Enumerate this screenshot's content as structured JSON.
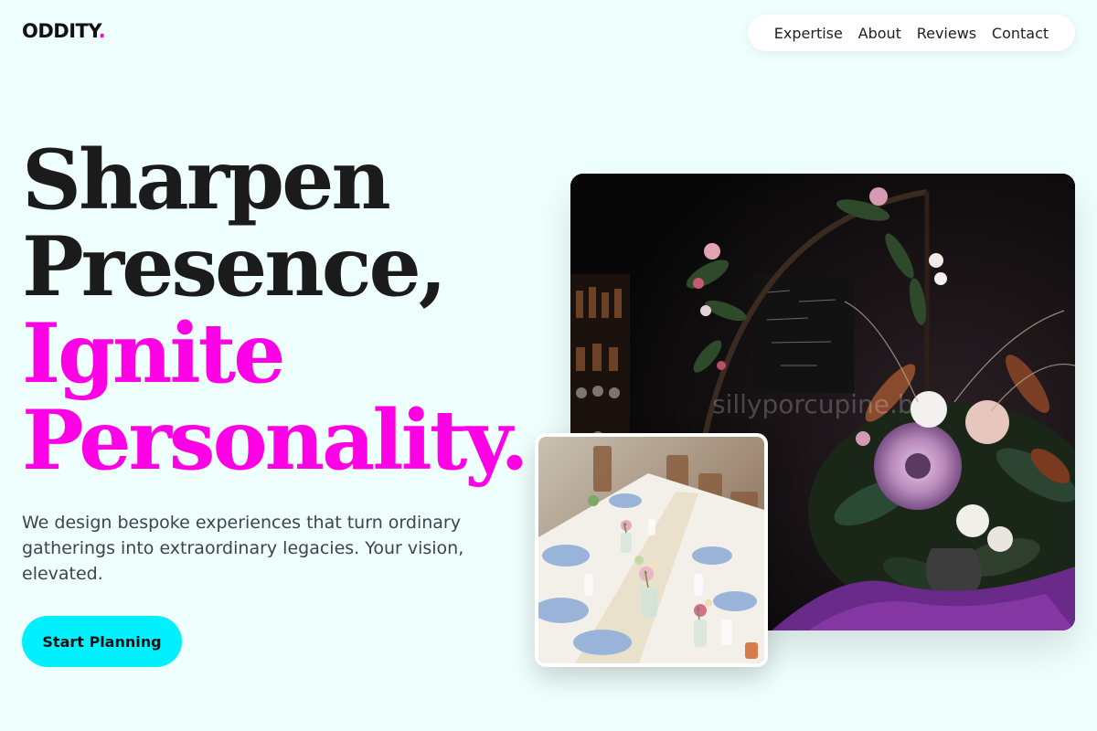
{
  "brand": {
    "name": "ODDITY",
    "dot": "."
  },
  "nav": {
    "items": [
      {
        "label": "Expertise"
      },
      {
        "label": "About"
      },
      {
        "label": "Reviews"
      },
      {
        "label": "Contact"
      }
    ]
  },
  "hero": {
    "headline_line1": "Sharpen",
    "headline_line2": "Presence,",
    "headline_line3": "Ignite",
    "headline_line4": "Personality.",
    "subtext": "We design bespoke experiences that turn ordinary gatherings into extraordinary legacies. Your vision, elevated.",
    "cta_label": "Start Planning"
  },
  "images": {
    "main_watermark": "sillyporcupine.b"
  },
  "colors": {
    "accent": "#ff00e6",
    "cta": "#00f0ff",
    "background": "#effffd"
  }
}
